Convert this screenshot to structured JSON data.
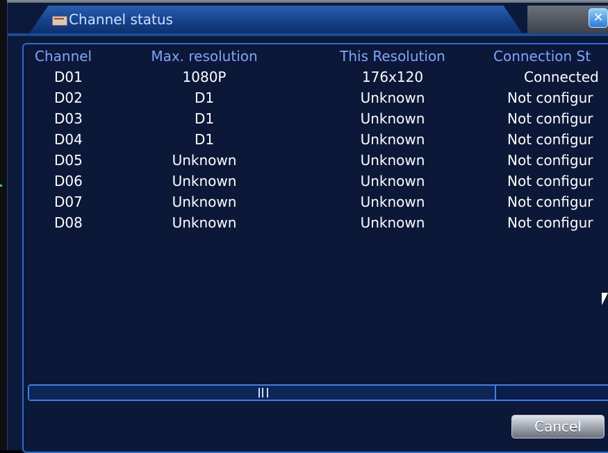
{
  "window": {
    "title": "Channel status",
    "close_icon": "close-icon",
    "mail_icon": "envelope-icon"
  },
  "table": {
    "columns": [
      "Channel",
      "Max. resolution",
      "This Resolution",
      "Connection St"
    ],
    "rows": [
      {
        "channel": "D01",
        "max_resolution": "1080P",
        "this_resolution": "176x120",
        "connection": "Connected"
      },
      {
        "channel": "D02",
        "max_resolution": "D1",
        "this_resolution": "Unknown",
        "connection": "Not configur"
      },
      {
        "channel": "D03",
        "max_resolution": "D1",
        "this_resolution": "Unknown",
        "connection": "Not configur"
      },
      {
        "channel": "D04",
        "max_resolution": "D1",
        "this_resolution": "Unknown",
        "connection": "Not configur"
      },
      {
        "channel": "D05",
        "max_resolution": "Unknown",
        "this_resolution": "Unknown",
        "connection": "Not configur"
      },
      {
        "channel": "D06",
        "max_resolution": "Unknown",
        "this_resolution": "Unknown",
        "connection": "Not configur"
      },
      {
        "channel": "D07",
        "max_resolution": "Unknown",
        "this_resolution": "Unknown",
        "connection": "Not configur"
      },
      {
        "channel": "D08",
        "max_resolution": "Unknown",
        "this_resolution": "Unknown",
        "connection": "Not configur"
      }
    ]
  },
  "footer": {
    "cancel_label": "Cancel"
  },
  "colors": {
    "background": "#0b1a3a",
    "header_text": "#7fa6ff",
    "row_text": "#ffffff",
    "accent": "#2d6bd1"
  }
}
